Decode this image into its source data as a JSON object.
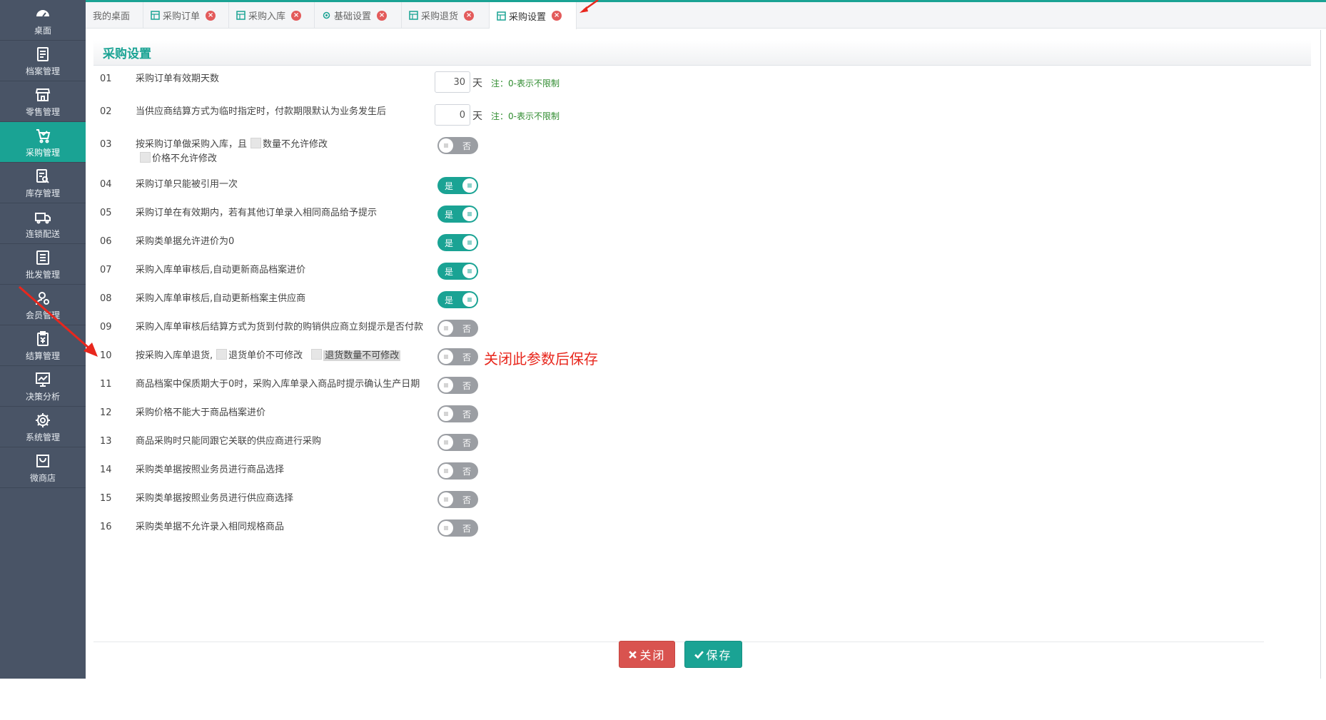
{
  "sidebar": {
    "items": [
      {
        "label": "桌面",
        "icon": "dashboard-icon"
      },
      {
        "label": "档案管理",
        "icon": "archive-icon"
      },
      {
        "label": "零售管理",
        "icon": "store-icon"
      },
      {
        "label": "采购管理",
        "icon": "purchase-icon"
      },
      {
        "label": "库存管理",
        "icon": "inventory-icon"
      },
      {
        "label": "连锁配送",
        "icon": "delivery-icon"
      },
      {
        "label": "批发管理",
        "icon": "wholesale-icon"
      },
      {
        "label": "会员管理",
        "icon": "member-icon"
      },
      {
        "label": "结算管理",
        "icon": "settlement-icon"
      },
      {
        "label": "决策分析",
        "icon": "analysis-icon"
      },
      {
        "label": "系统管理",
        "icon": "gear-icon"
      },
      {
        "label": "微商店",
        "icon": "shop-bag-icon"
      }
    ],
    "active_index": 3
  },
  "tabs": [
    {
      "label": "我的桌面",
      "closable": false
    },
    {
      "label": "采购订单",
      "closable": true
    },
    {
      "label": "采购入库",
      "closable": true
    },
    {
      "label": "基础设置",
      "closable": true
    },
    {
      "label": "采购退货",
      "closable": true
    },
    {
      "label": "采购设置",
      "closable": true
    }
  ],
  "page": {
    "title": "采购设置"
  },
  "unit_label": "天",
  "on_text": "是",
  "off_text": "否",
  "settings": [
    {
      "num": "01",
      "label": "采购订单有效期天数",
      "value": "30",
      "note": "注：0-表示不限制"
    },
    {
      "num": "02",
      "label": "当供应商结算方式为临时指定时，付款期限默认为业务发生后",
      "value": "0",
      "note": "注：0-表示不限制"
    },
    {
      "num": "03",
      "label_a": "按采购订单做采购入库，且",
      "label_b": "数量不允许修改",
      "label_c": "价格不允许修改",
      "state": "否"
    },
    {
      "num": "04",
      "label": "采购订单只能被引用一次",
      "state": "是"
    },
    {
      "num": "05",
      "label": "采购订单在有效期内，若有其他订单录入相同商品给予提示",
      "state": "是"
    },
    {
      "num": "06",
      "label": "采购类单据允许进价为0",
      "state": "是"
    },
    {
      "num": "07",
      "label": "采购入库单审核后,自动更新商品档案进价",
      "state": "是"
    },
    {
      "num": "08",
      "label": "采购入库单审核后,自动更新档案主供应商",
      "state": "是"
    },
    {
      "num": "09",
      "label": "采购入库单审核后结算方式为货到付款的购销供应商立刻提示是否付款",
      "state": "否"
    },
    {
      "num": "10",
      "label_a": "按采购入库单退货,",
      "label_b": "退货单价不可修改",
      "label_c": "退货数量不可修改",
      "state": "否",
      "annotation": "关闭此参数后保存"
    },
    {
      "num": "11",
      "label": "商品档案中保质期大于0时，采购入库单录入商品时提示确认生产日期",
      "state": "否"
    },
    {
      "num": "12",
      "label": "采购价格不能大于商品档案进价",
      "state": "否"
    },
    {
      "num": "13",
      "label": "商品采购时只能同跟它关联的供应商进行采购",
      "state": "否"
    },
    {
      "num": "14",
      "label": "采购类单据按照业务员进行商品选择",
      "state": "否"
    },
    {
      "num": "15",
      "label": "采购类单据按照业务员进行供应商选择",
      "state": "否"
    },
    {
      "num": "16",
      "label": "采购类单据不允许录入相同规格商品",
      "state": "否"
    }
  ],
  "buttons": {
    "close_label": "关闭",
    "save_label": "保存"
  },
  "colors": {
    "accent": "#1aa394",
    "sidebar_bg": "#495466",
    "danger": "#d9534f",
    "note_green": "#2e8b2e",
    "annotation_red": "#e8271d"
  }
}
